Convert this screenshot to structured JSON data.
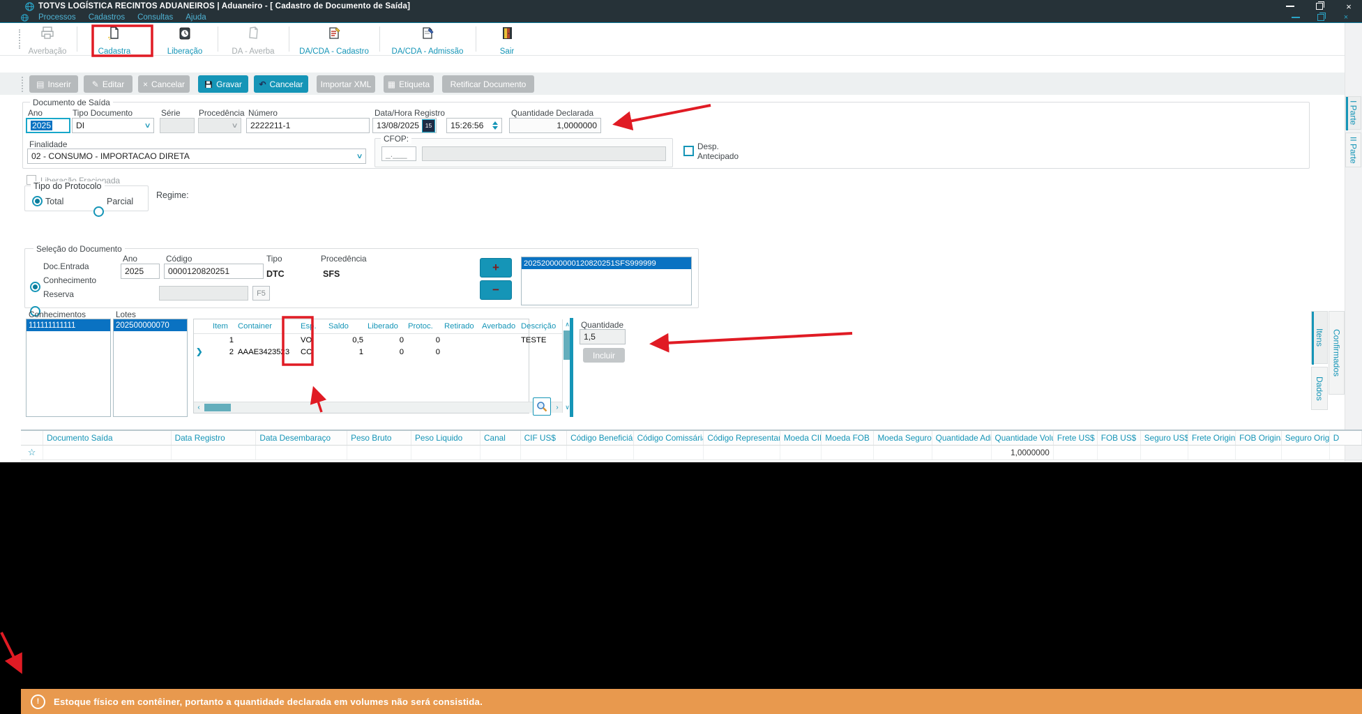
{
  "titlebar": {
    "title": "TOTVS LOGÍSTICA RECINTOS ADUANEIROS | Aduaneiro - [ Cadastro de Documento de Saída]"
  },
  "menubar": {
    "items": [
      "Processos",
      "Cadastros",
      "Consultas",
      "Ajuda"
    ]
  },
  "toolbar": {
    "items": [
      {
        "label": "Averbação"
      },
      {
        "label": "Cadastra"
      },
      {
        "label": "Liberação"
      },
      {
        "label": "DA - Averba"
      },
      {
        "label": "DA/CDA - Cadastro"
      },
      {
        "label": "DA/CDA - Admissão"
      },
      {
        "label": "Sair"
      }
    ]
  },
  "actions": {
    "inserir": "Inserir",
    "editar": "Editar",
    "cancelar": "Cancelar",
    "gravar": "Gravar",
    "cancelar2": "Cancelar",
    "importar_xml": "Importar XML",
    "etiqueta": "Etiqueta",
    "retificar": "Retificar Documento"
  },
  "doc_saida": {
    "legend": "Documento de Saída",
    "ano": {
      "label": "Ano",
      "value": "2025"
    },
    "tipo_documento": {
      "label": "Tipo Documento",
      "value": "DI"
    },
    "serie": {
      "label": "Série",
      "value": ""
    },
    "procedencia": {
      "label": "Procedência",
      "value": ""
    },
    "numero": {
      "label": "Número",
      "value": "2222211-1"
    },
    "data_hora": {
      "label": "Data/Hora Registro",
      "date": "13/08/2025",
      "calendar": "15",
      "time": "15:26:56"
    },
    "quantidade_declarada": {
      "label": "Quantidade Declarada",
      "value": "1,0000000"
    },
    "finalidade": {
      "label": "Finalidade",
      "value": "02 - CONSUMO - IMPORTACAO DIRETA"
    },
    "cfop": {
      "legend": "CFOP:",
      "mask": "_.___",
      "value": ""
    },
    "desp_antecipado": {
      "line1": "Desp.",
      "line2": "Antecipado"
    }
  },
  "liberacao_fracionada": {
    "label": "Liberação Fracionada"
  },
  "tipo_protocolo": {
    "legend": "Tipo do Protocolo",
    "total": "Total",
    "parcial": "Parcial"
  },
  "regime": {
    "label": "Regime:"
  },
  "selecao": {
    "legend": "Seleção do Documento",
    "radio_doc_entrada": "Doc.Entrada",
    "radio_conhecimento": "Conhecimento",
    "radio_reserva": "Reserva",
    "ano": {
      "label": "Ano",
      "value": "2025"
    },
    "codigo": {
      "label": "Código",
      "value": "0000120820251"
    },
    "tipo": {
      "label": "Tipo",
      "value": "DTC"
    },
    "procedencia": {
      "label": "Procedência",
      "value": "SFS"
    },
    "add_label": "+",
    "remove_label": "−",
    "f5_label": "F5",
    "documento_selecionado": "202520000000120820251SFS999999"
  },
  "conhecimentos": {
    "label": "Conhecimentos",
    "item0": "111111111111"
  },
  "lotes": {
    "label": "Lotes",
    "item0": "202500000070"
  },
  "container_grid": {
    "columns": [
      "Item",
      "Container",
      "Esp.",
      "Saldo",
      "Liberado",
      "Protoc.",
      "Retirado",
      "Averbado",
      "Descrição"
    ],
    "rows": [
      {
        "item": "1",
        "container": "",
        "esp": "VO",
        "saldo": "0,5",
        "liberado": "0",
        "protoc": "0",
        "retirado": "",
        "averbado": "",
        "descricao": "TESTE"
      },
      {
        "item": "2",
        "container": "AAAE3423523",
        "esp": "CC",
        "saldo": "1",
        "liberado": "0",
        "protoc": "0",
        "retirado": "",
        "averbado": "",
        "descricao": ""
      }
    ]
  },
  "quantidade": {
    "label": "Quantidade",
    "value": "1,5",
    "button": "Incluir"
  },
  "side_tabs": {
    "itens": "Itens",
    "confirmados": "Confirmados",
    "dados": "Dados"
  },
  "parte_tabs": {
    "parte1": "I Parte",
    "parte2": "II Parte"
  },
  "bottom_grid": {
    "columns": [
      "Documento Saída",
      "Data Registro",
      "Data Desembaraço",
      "Peso Bruto",
      "Peso Liquido",
      "Canal",
      "CIF US$",
      "Código Beneficiário",
      "Código Comissária",
      "Código Representante",
      "Moeda CIF",
      "Moeda FOB",
      "Moeda Seguro",
      "Quantidade Adições",
      "Quantidade Volumes",
      "Frete US$",
      "FOB US$",
      "Seguro US$",
      "Frete Original",
      "FOB Original",
      "Seguro Original",
      "D"
    ],
    "row": {
      "star": "☆",
      "quantidade_volumes": "1,0000000"
    }
  },
  "message_bar": {
    "icon": "!",
    "text": "Estoque físico em contêiner, portanto a quantidade declarada em volumes não será consistida."
  },
  "colors": {
    "accent_teal": "#1595b7",
    "selection_blue": "#0a72c2",
    "message_orange": "#e8994e",
    "annotation_red": "#e01b24",
    "titlebar": "#263238"
  }
}
